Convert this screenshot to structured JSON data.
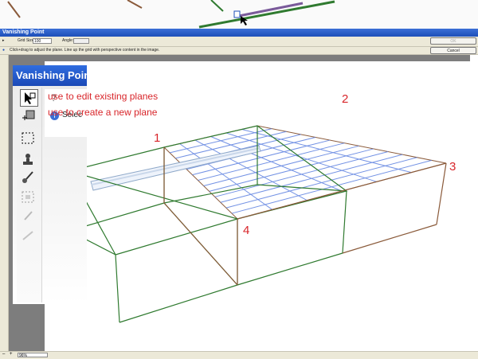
{
  "window": {
    "title": "Vanishing Point"
  },
  "options": {
    "grid_size_label": "Grid Size:",
    "grid_size_value": "100",
    "angle_label": "Angle:",
    "ok_label": "OK",
    "cancel_label": "Cancel"
  },
  "hint": {
    "text": "Click+drag to adjust the plane. Line up the grid with perspective content in the image."
  },
  "status": {
    "zoom": "96%"
  },
  "inset": {
    "title": "Vanishing Point",
    "tooltip_prefix": "Selec"
  },
  "annotations": {
    "edit_planes": "use to edit existing planes",
    "create_plane": "use to create a new plane",
    "corner_1": "1",
    "corner_2": "2",
    "corner_3": "3",
    "corner_4": "4"
  },
  "colors": {
    "annotation": "#d8252a",
    "plane_green": "#2f7a2f",
    "plane_brown": "#8a5a3a",
    "grid_blue": "#5b7fe0"
  }
}
